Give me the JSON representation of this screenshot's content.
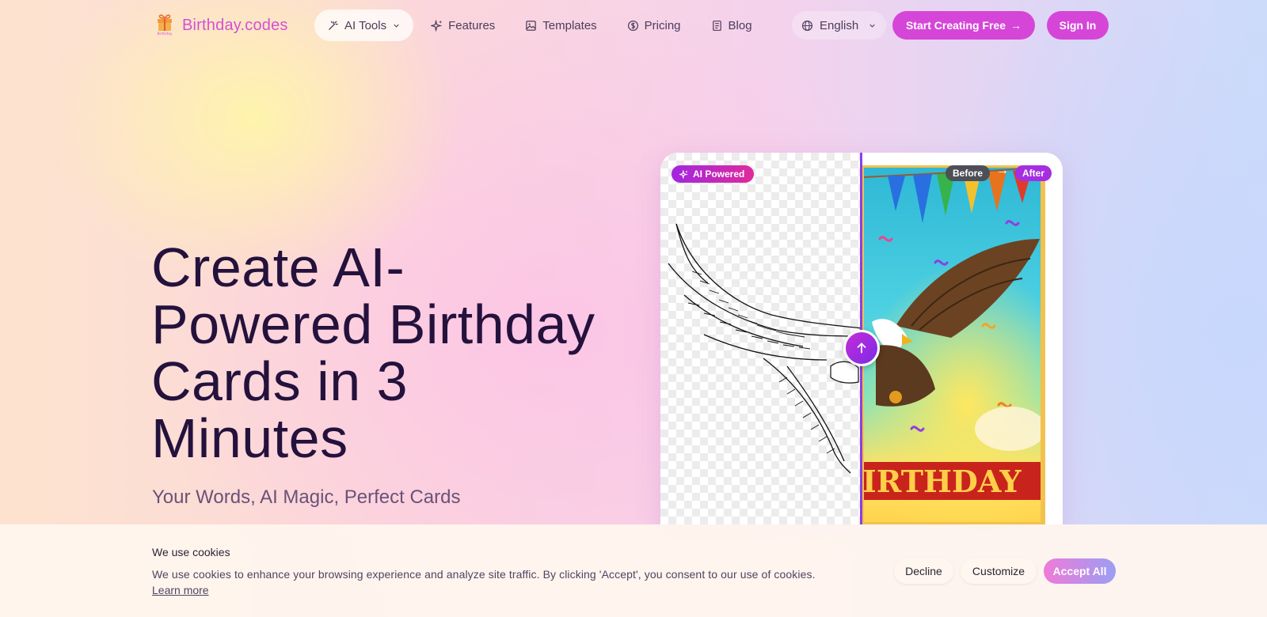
{
  "brand": {
    "name": "Birthday.codes",
    "accent": "#d546d8"
  },
  "nav": {
    "items": [
      {
        "label": "AI Tools",
        "icon": "wand-icon",
        "has_dropdown": true
      },
      {
        "label": "Features",
        "icon": "sparkles-icon"
      },
      {
        "label": "Templates",
        "icon": "image-icon"
      },
      {
        "label": "Pricing",
        "icon": "dollar-circle-icon"
      },
      {
        "label": "Blog",
        "icon": "document-icon"
      }
    ],
    "language": "English",
    "start_button": "Start Creating Free",
    "signin_button": "Sign In"
  },
  "hero": {
    "title_lines": [
      "Create AI-",
      "Powered Birthday",
      "Cards in 3",
      "Minutes"
    ],
    "subtitle": "Your Words, AI Magic, Perfect Cards"
  },
  "preview": {
    "ai_badge": "AI Powered",
    "before_label": "Before",
    "after_label": "After",
    "banner_text": "IRTHDAY"
  },
  "cookie": {
    "title": "We use cookies",
    "text": "We use cookies to enhance your browsing experience and analyze site traffic. By clicking 'Accept', you consent to our use of cookies.",
    "learn_more": "Learn more",
    "decline": "Decline",
    "customize": "Customize",
    "accept": "Accept All"
  }
}
